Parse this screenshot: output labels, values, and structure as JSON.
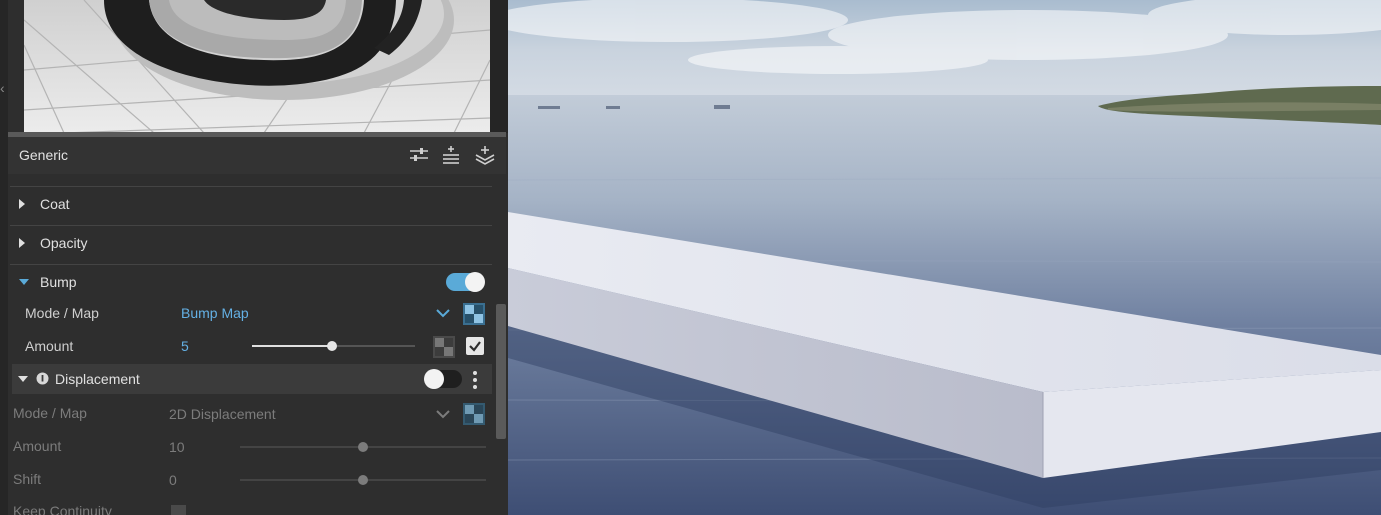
{
  "material": {
    "name": "Generic",
    "header_icons": [
      "adjust-sliders-icon",
      "add-layer-list-icon",
      "add-stack-icon"
    ]
  },
  "sections": [
    {
      "label": "Coat",
      "expanded": false
    },
    {
      "label": "Opacity",
      "expanded": false
    },
    {
      "label": "Bump",
      "expanded": true,
      "enabled": true
    },
    {
      "label": "Displacement",
      "expanded": true,
      "enabled": false
    }
  ],
  "bump": {
    "mode_label": "Mode / Map",
    "mode_value": "Bump Map",
    "amount_label": "Amount",
    "amount_value": "5",
    "amount_fraction": 0.49,
    "use_checked": true
  },
  "displacement": {
    "mode_label": "Mode / Map",
    "mode_value": "2D Displacement",
    "amount_label": "Amount",
    "amount_value": "10",
    "amount_fraction": 0.5,
    "shift_label": "Shift",
    "shift_value": "0",
    "shift_fraction": 0.5,
    "keep_label": "Keep Continuity"
  },
  "colors": {
    "accent": "#5aaad8",
    "panel_bg": "#2e2e2e",
    "water": "#4a5a80",
    "slab": "#e4e6ef"
  }
}
